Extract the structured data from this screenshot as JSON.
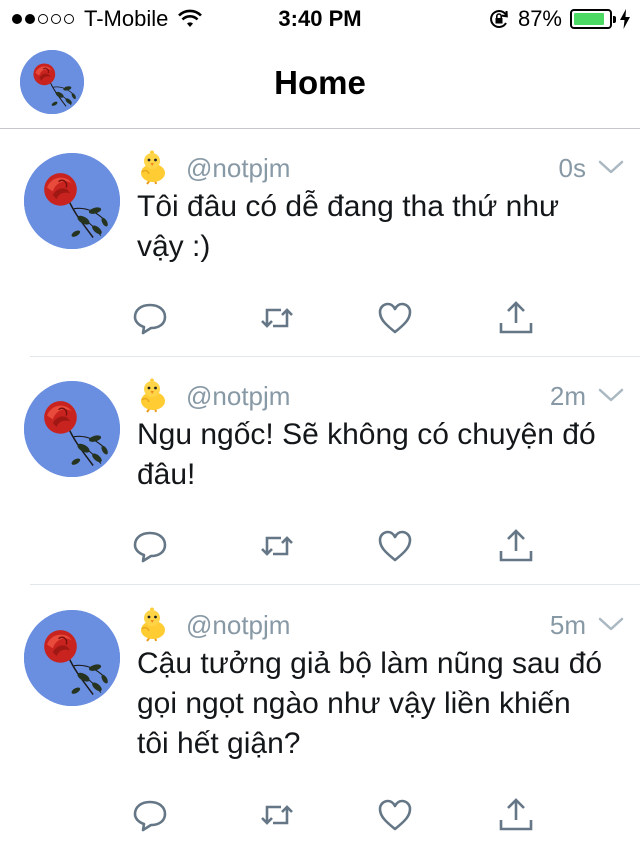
{
  "status_bar": {
    "carrier": "T-Mobile",
    "signal_bars_filled": 2,
    "signal_bars_total": 5,
    "time": "3:40 PM",
    "battery_percent_label": "87%",
    "battery_level": 0.87
  },
  "nav": {
    "title": "Home"
  },
  "tweets": [
    {
      "handle": "@notpjm",
      "time": "0s",
      "text": "Tôi đâu có dễ đang tha thứ như vậy :)"
    },
    {
      "handle": "@notpjm",
      "time": "2m",
      "text": "Ngu ngốc! Sẽ không có chuyện đó đâu!"
    },
    {
      "handle": "@notpjm",
      "time": "5m",
      "text": "Cậu tưởng giả bộ làm nũng sau đó gọi ngọt ngào như vậy liền khiến tôi hết giận?"
    }
  ],
  "icons": {
    "reply": "reply-icon",
    "retweet": "retweet-icon",
    "like": "heart-icon",
    "share": "share-icon",
    "more": "chevron-down-icon"
  },
  "colors": {
    "muted": "#8899a6",
    "icon": "#657786",
    "battery": "#4cd964",
    "avatar_bg": "#6a8ee0",
    "rose": "#d8322e"
  }
}
